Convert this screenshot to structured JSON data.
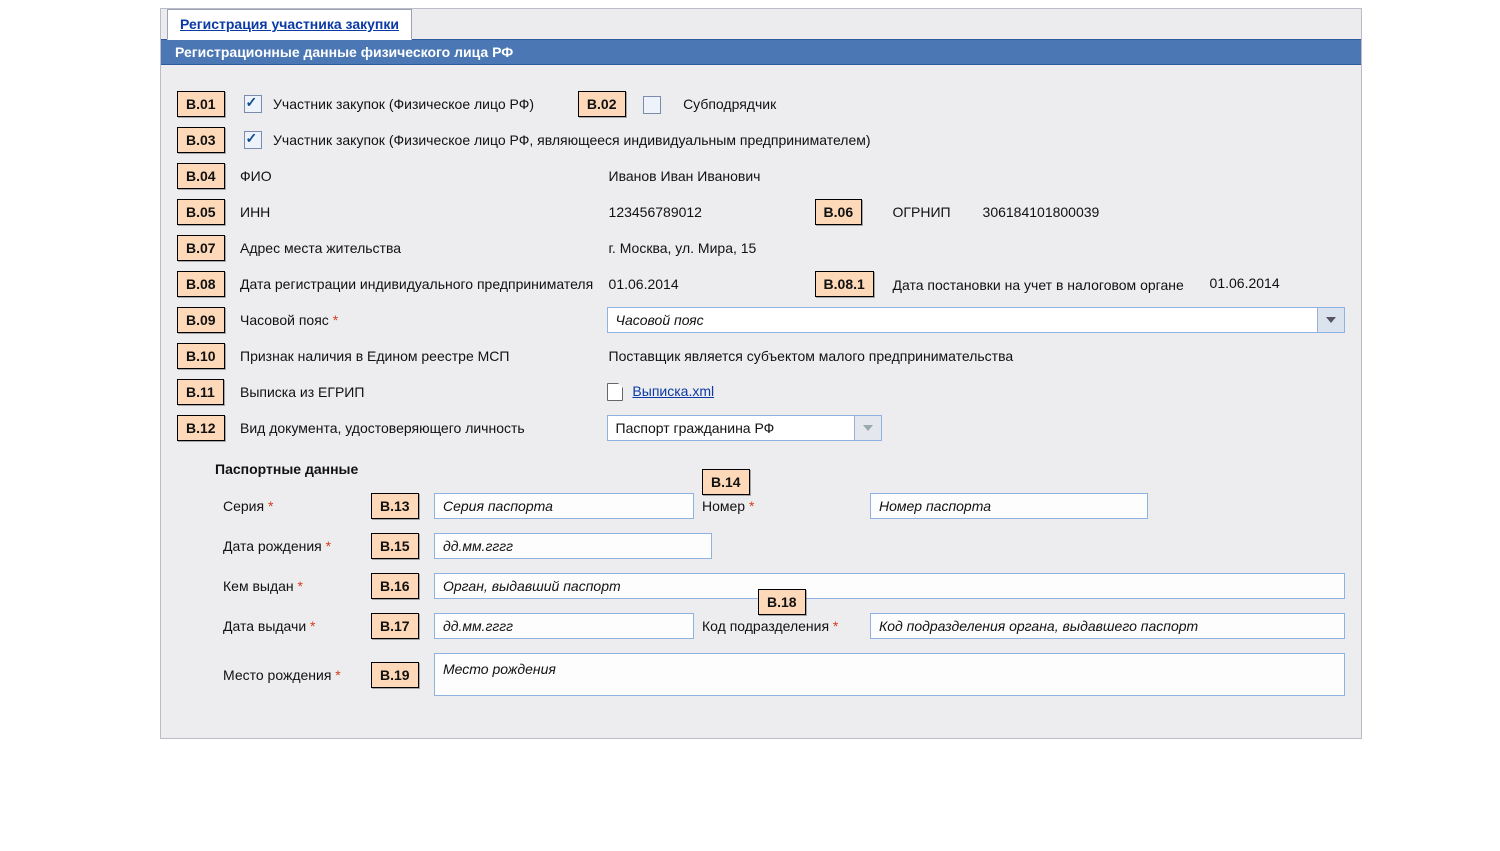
{
  "tab_title": "Регистрация участника закупки",
  "section_header": "Регистрационные данные физического лица РФ",
  "codes": {
    "b01": "B.01",
    "b02": "B.02",
    "b03": "B.03",
    "b04": "B.04",
    "b05": "B.05",
    "b06": "B.06",
    "b07": "B.07",
    "b08": "B.08",
    "b08_1": "B.08.1",
    "b09": "B.09",
    "b10": "B.10",
    "b11": "B.11",
    "b12": "B.12",
    "b13": "B.13",
    "b14": "B.14",
    "b15": "B.15",
    "b16": "B.16",
    "b17": "B.17",
    "b18": "B.18",
    "b19": "B.19"
  },
  "labels": {
    "b01": "Участник закупок (Физическое лицо РФ)",
    "b02": "Субподрядчик",
    "b03": "Участник закупок (Физическое лицо РФ, являющееся индивидуальным предпринимателем)",
    "b04": "ФИО",
    "b05": "ИНН",
    "b06": "ОГРНИП",
    "b07": "Адрес места жительства",
    "b08": "Дата регистрации индивидуального предпринимателя",
    "b08_1": "Дата постановки на учет в налоговом органе",
    "b09": "Часовой пояс",
    "b10": "Признак наличия в Едином реестре МСП",
    "b11": "Выписка из ЕГРИП",
    "b12": "Вид документа, удостоверяющего личность",
    "passport_section": "Паспортные данные",
    "series": "Серия",
    "number": "Номер",
    "birth_date": "Дата рождения",
    "issued_by": "Кем выдан",
    "issue_date": "Дата выдачи",
    "dept_code": "Код подразделения",
    "birth_place": "Место рождения"
  },
  "values": {
    "b01_checked": true,
    "b02_checked": false,
    "b03_checked": true,
    "fio": "Иванов Иван Иванович",
    "inn": "123456789012",
    "ogrnip": "306184101800039",
    "address": "г. Москва, ул. Мира, 15",
    "reg_date": "01.06.2014",
    "tax_date": "01.06.2014",
    "timezone_placeholder": "Часовой пояс",
    "msp": "Поставщик является субъектом малого предпринимательства",
    "file_name": "Выписка.xml",
    "doc_type": "Паспорт гражданина РФ"
  },
  "placeholders": {
    "series": "Серия паспорта",
    "number": "Номер паспорта",
    "date": "дд.мм.гггг",
    "issued_by": "Орган, выдавший паспорт",
    "dept_code": "Код подразделения органа, выдавшего паспорт",
    "birth_place": "Место рождения"
  },
  "required_marker": "*"
}
